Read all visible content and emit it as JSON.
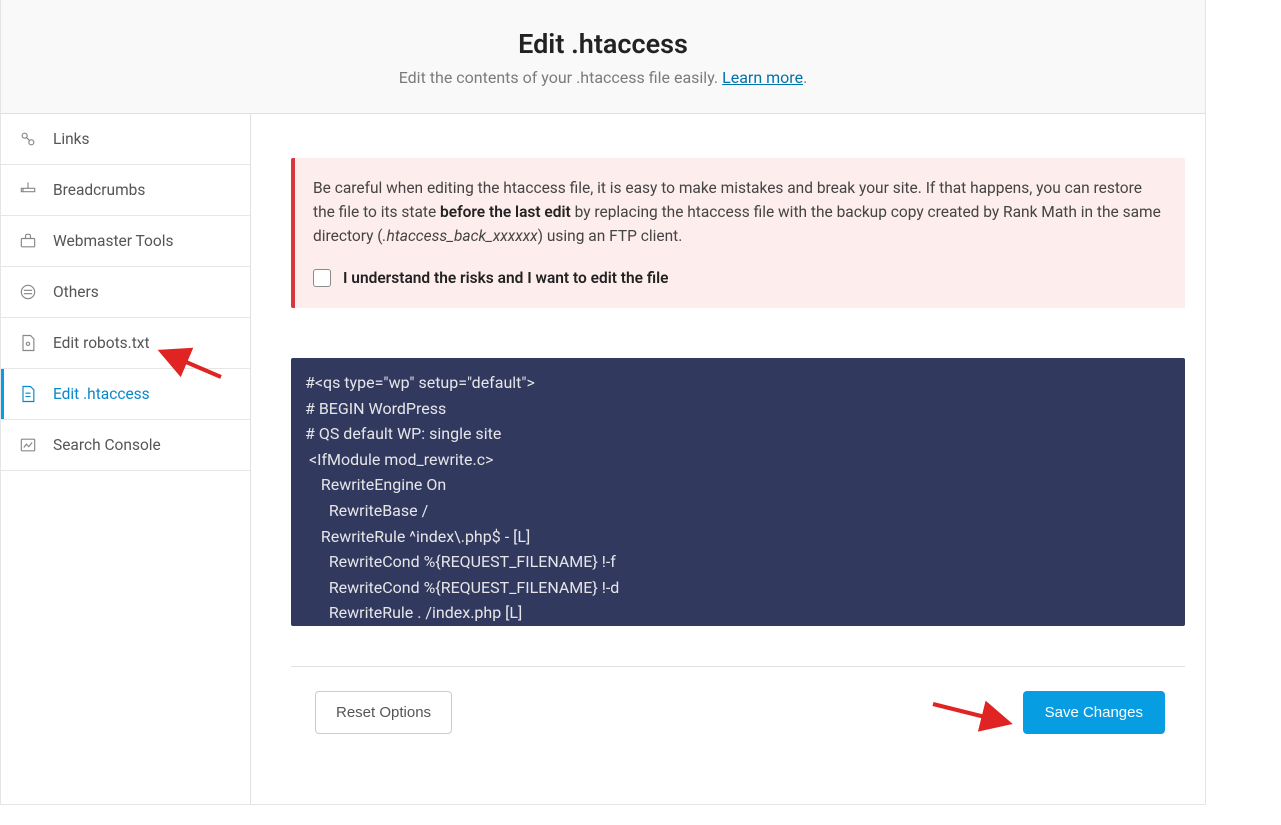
{
  "header": {
    "title": "Edit .htaccess",
    "subtitle_prefix": "Edit the contents of your .htaccess file easily. ",
    "learn_more": "Learn more",
    "subtitle_suffix": "."
  },
  "sidebar": {
    "items": [
      {
        "label": "Links",
        "icon": "links"
      },
      {
        "label": "Breadcrumbs",
        "icon": "breadcrumbs"
      },
      {
        "label": "Webmaster Tools",
        "icon": "toolbox"
      },
      {
        "label": "Others",
        "icon": "others"
      },
      {
        "label": "Edit robots.txt",
        "icon": "robots"
      },
      {
        "label": "Edit .htaccess",
        "icon": "htaccess",
        "active": true
      },
      {
        "label": "Search Console",
        "icon": "console"
      }
    ]
  },
  "warning": {
    "text_before_bold": "Be careful when editing the htaccess file, it is easy to make mistakes and break your site. If that happens, you can restore the file to its state ",
    "bold_text": "before the last edit",
    "text_after_bold": " by replacing the htaccess file with the backup copy created by Rank Math in the same directory (",
    "italic_text": ".htaccess_back_xxxxxx",
    "text_end": ") using an FTP client.",
    "checkbox_label": "I understand the risks and I want to edit the file"
  },
  "editor": {
    "content": "#<qs type=\"wp\" setup=\"default\">\n# BEGIN WordPress\n# QS default WP: single site\n <IfModule mod_rewrite.c>\n    RewriteEngine On\n      RewriteBase /\n    RewriteRule ^index\\.php$ - [L]\n      RewriteCond %{REQUEST_FILENAME} !-f\n      RewriteCond %{REQUEST_FILENAME} !-d\n      RewriteRule . /index.php [L]\n </IfModule>"
  },
  "footer": {
    "reset_label": "Reset Options",
    "save_label": "Save Changes"
  }
}
